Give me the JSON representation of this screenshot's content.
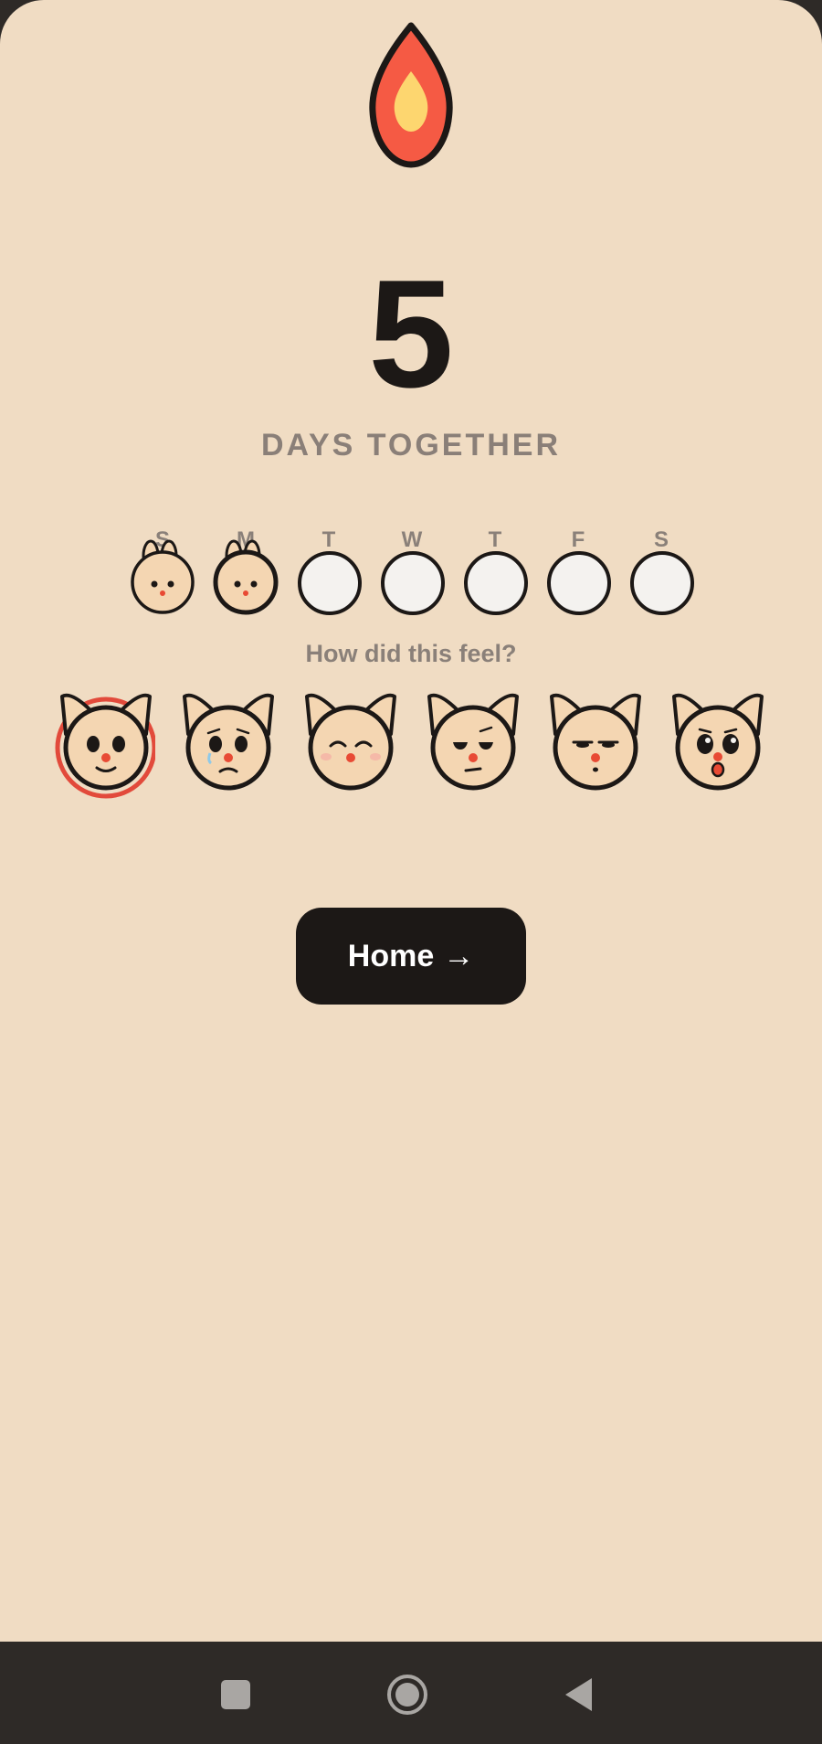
{
  "streak": {
    "count": "5",
    "label": "DAYS TOGETHER"
  },
  "week": {
    "days": [
      {
        "letter": "S",
        "state": "done"
      },
      {
        "letter": "M",
        "state": "today"
      },
      {
        "letter": "T",
        "state": "empty"
      },
      {
        "letter": "W",
        "state": "empty"
      },
      {
        "letter": "T",
        "state": "empty"
      },
      {
        "letter": "F",
        "state": "empty"
      },
      {
        "letter": "S",
        "state": "empty"
      }
    ]
  },
  "mood": {
    "prompt": "How did this feel?",
    "options": [
      "happy-face",
      "sad-face",
      "content-face",
      "unsure-face",
      "bored-face",
      "surprised-face"
    ],
    "selected_index": 0
  },
  "home_button": {
    "label": "Home",
    "arrow": "→"
  },
  "colors": {
    "background": "#f0dcc3",
    "ink": "#1c1816",
    "flame_outer": "#f55a44",
    "flame_inner": "#fdd66f",
    "selected_ring": "#e24a3b",
    "face": "#f4d6b2",
    "nose": "#e84a34",
    "navbar": "#2e2a27"
  },
  "navbar": {
    "icons": [
      "recents-icon",
      "home-circle-icon",
      "back-icon"
    ]
  }
}
